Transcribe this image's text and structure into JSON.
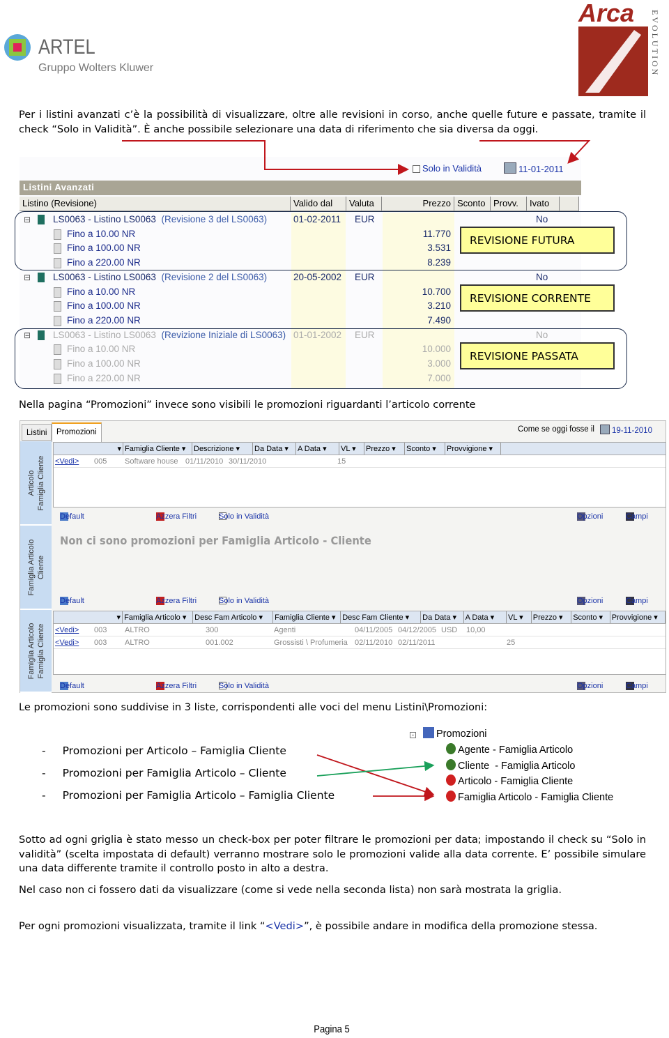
{
  "header": {
    "left_logo": {
      "brand": "ARTEL",
      "sub": "Gruppo Wolters Kluwer"
    },
    "right_logo": {
      "brand": "Arca",
      "sub": "EVOLUTION"
    }
  },
  "paragraphs": {
    "p1": "Per i listini avanzati c’è la possibilità di visualizzare, oltre alle revisioni in corso, anche quelle future e passate, tramite il check “Solo in Validità”. È anche possibile selezionare una data di riferimento che sia diversa da oggi.",
    "p2": "Nella pagina “Promozioni” invece sono visibili le promozioni riguardanti l’articolo corrente",
    "p3": "Le promozioni sono suddivise in 3 liste, corrispondenti alle voci del menu Listini\\Promozioni:",
    "p4": "Sotto ad ogni griglia è stato messo un check-box per poter filtrare le promozioni per data; impostando il check su “Solo in validità” (scelta impostata di default) verranno mostrare solo le promozioni valide alla data corrente. E’ possibile simulare una data differente tramite il controllo posto in alto a destra.",
    "p5": "Nel caso non ci fossero dati da visualizzare (come si vede nella seconda lista) non sarà mostrata la griglia.",
    "p6a": "Per ogni promozioni visualizzata, tramite il link “",
    "p6link": "<Vedi>",
    "p6b": "”, è possibile andare in modifica della promozione stessa."
  },
  "listini": {
    "solo_validita": "Solo in Validità",
    "solo_validita_checked": false,
    "date": "11-01-2011",
    "title": "Listini Avanzati",
    "columns": [
      "Listino (Revisione)",
      "Valido dal",
      "Valuta",
      "Prezzo",
      "Sconto",
      "Provv.",
      "Ivato"
    ],
    "revisions": [
      {
        "name": "LS0063 - Listino LS0063",
        "rev": "(Revisione 3 del LS0063)",
        "valido": "01-02-2011",
        "valuta": "EUR",
        "ivato": "No",
        "state": "future",
        "label": "REVISIONE FUTURA",
        "rows": [
          {
            "name": "Fino a 10.00 NR",
            "prezzo": "11.770"
          },
          {
            "name": "Fino a 100.00 NR",
            "prezzo": "3.531"
          },
          {
            "name": "Fino a 220.00 NR",
            "prezzo": "8.239"
          }
        ]
      },
      {
        "name": "LS0063 - Listino LS0063",
        "rev": "(Revisione 2 del LS0063)",
        "valido": "20-05-2002",
        "valuta": "EUR",
        "ivato": "No",
        "state": "current",
        "label": "REVISIONE CORRENTE",
        "rows": [
          {
            "name": "Fino a 10.00 NR",
            "prezzo": "10.700"
          },
          {
            "name": "Fino a 100.00 NR",
            "prezzo": "3.210"
          },
          {
            "name": "Fino a 220.00 NR",
            "prezzo": "7.490"
          }
        ]
      },
      {
        "name": "LS0063 - Listino LS0063",
        "rev": "(Revizione Iniziale di LS0063)",
        "valido": "01-01-2002",
        "valuta": "EUR",
        "ivato": "No",
        "state": "past",
        "label": "REVISIONE PASSATA",
        "rows": [
          {
            "name": "Fino a 10.00 NR",
            "prezzo": "10.000"
          },
          {
            "name": "Fino a 100.00 NR",
            "prezzo": "3.000"
          },
          {
            "name": "Fino a 220.00 NR",
            "prezzo": "7.000"
          }
        ]
      }
    ]
  },
  "promozioni": {
    "tabs": [
      "Listini",
      "Promozioni"
    ],
    "active_tab": "Promozioni",
    "today_label": "Come se oggi fosse il",
    "today_date": "19-11-2010",
    "toolbar": {
      "default": "Default",
      "azzera": "Azzera Filtri",
      "solo": "Solo in Validità",
      "opzioni": "Opzioni",
      "campi": "Campi"
    },
    "sections": [
      {
        "side": [
          "Articolo",
          "Famiglia Cliente"
        ],
        "columns": [
          "Famiglia Cliente",
          "Descrizione",
          "Da Data",
          "A Data",
          "VL",
          "Prezzo",
          "Sconto",
          "Provvigione"
        ],
        "rows": [
          [
            "<Vedi>",
            "005",
            "Software house",
            "01/11/2010",
            "30/11/2010",
            "",
            "",
            "15",
            ""
          ]
        ]
      },
      {
        "side": [
          "Famiglia Articolo",
          "Cliente"
        ],
        "empty_message": "Non ci sono promozioni per Famiglia Articolo - Cliente"
      },
      {
        "side": [
          "Famiglia Articolo",
          "Famiglia Cliente"
        ],
        "columns": [
          "Famiglia Articolo",
          "Desc Fam Articolo",
          "Famiglia Cliente",
          "Desc Fam Cliente",
          "Da Data",
          "A Data",
          "VL",
          "Prezzo",
          "Sconto",
          "Provvigione"
        ],
        "rows": [
          [
            "<Vedi>",
            "003",
            "ALTRO",
            "300",
            "Agenti",
            "04/11/2005",
            "04/12/2005",
            "USD",
            "10,00",
            "",
            ""
          ],
          [
            "<Vedi>",
            "003",
            "ALTRO",
            "001.002",
            "Grossisti \\ Profumeria",
            "02/11/2010",
            "02/11/2011",
            "",
            "",
            "25",
            ""
          ]
        ]
      }
    ]
  },
  "list_items": [
    "Promozioni per Articolo – Famiglia Cliente",
    "Promozioni per Famiglia Articolo – Cliente",
    "Promozioni per Famiglia Articolo – Famiglia Cliente"
  ],
  "menu_tree": {
    "root": "Promozioni",
    "items": [
      "Agente - Famiglia Articolo",
      "Cliente  - Famiglia Articolo",
      "Articolo - Famiglia Cliente",
      "Famiglia Articolo - Famiglia Cliente"
    ]
  },
  "footer": {
    "page": "Pagina 5"
  },
  "colors": {
    "arrow_red": "#c0161c",
    "arrow_green": "#1aa05a",
    "label_yellow": "#ffff99",
    "link_blue": "#1a33a8",
    "side_blue": "#c8dcf2"
  }
}
